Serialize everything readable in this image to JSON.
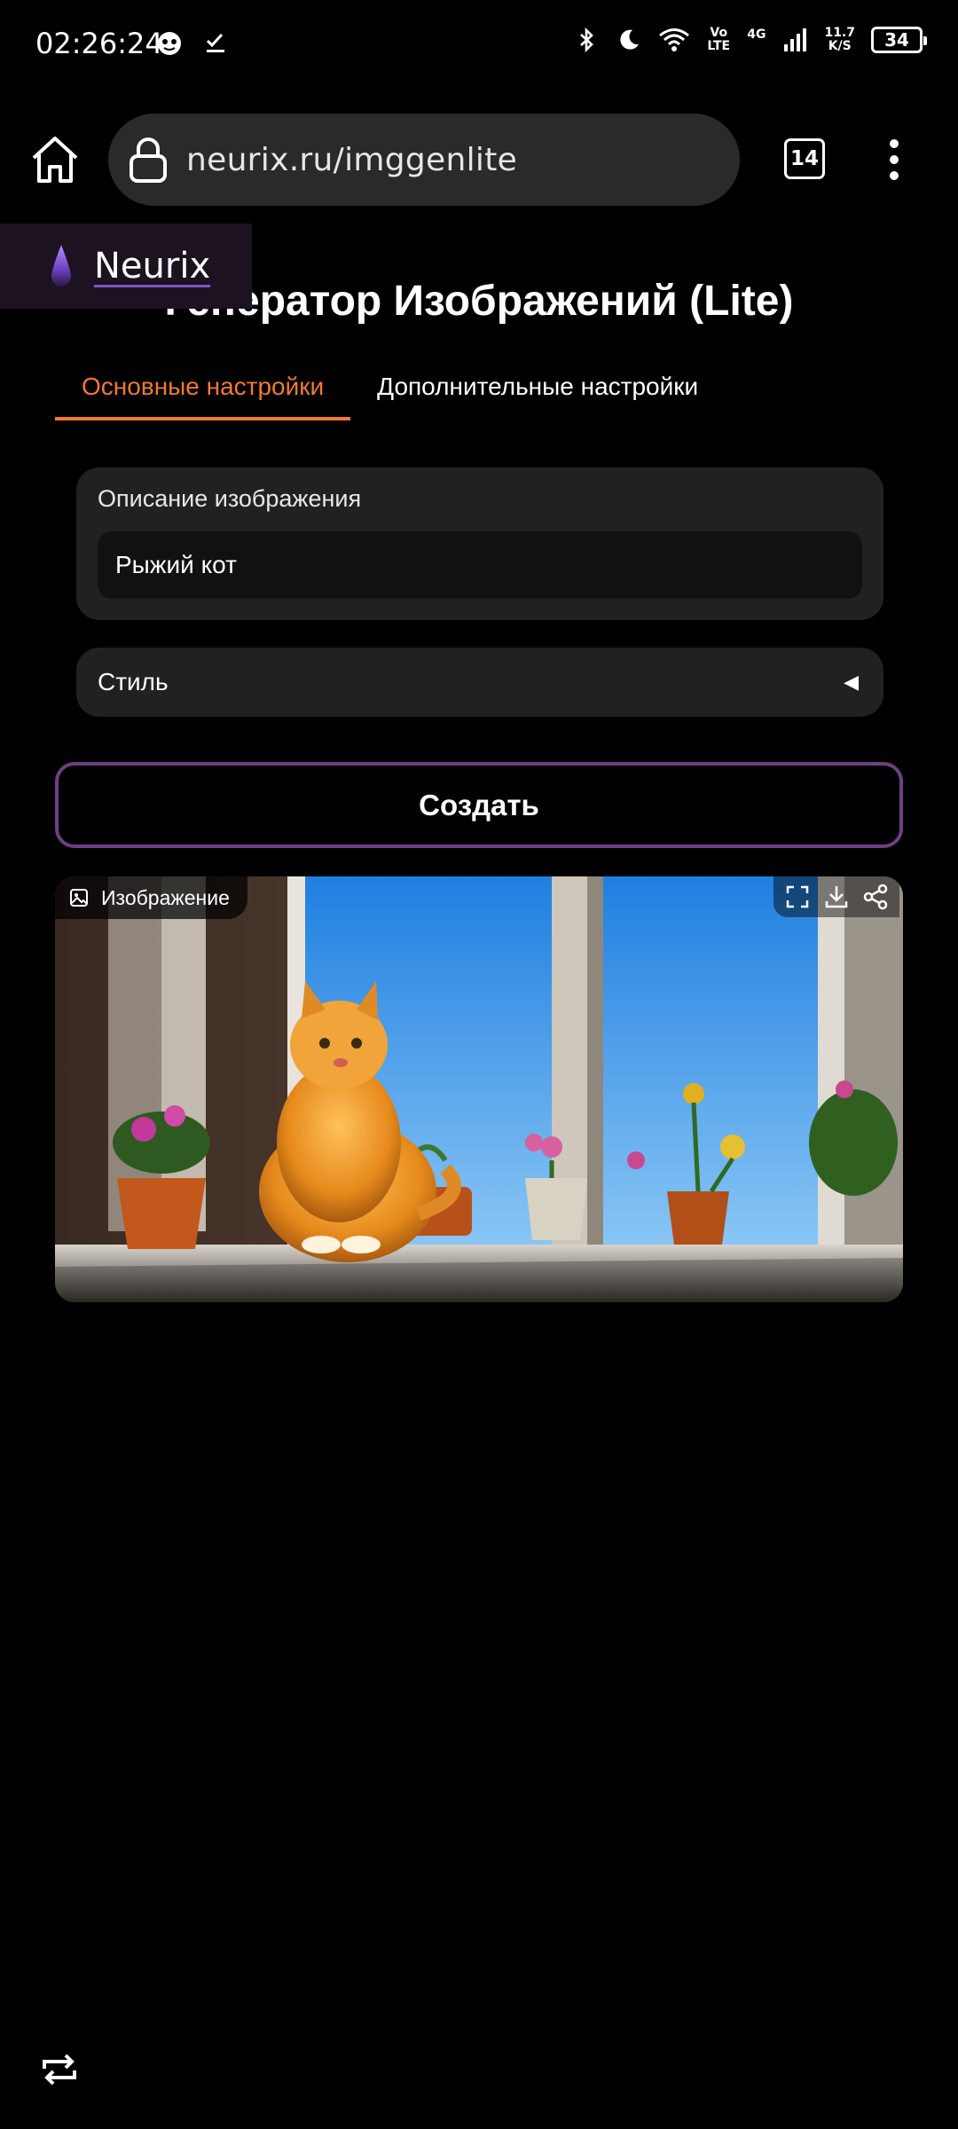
{
  "status_bar": {
    "time": "02:26:24",
    "volte": "Vo LTE",
    "network": "4G",
    "speed_value": "11.7",
    "speed_unit": "K/S",
    "battery": "34"
  },
  "browser": {
    "url": "neurix.ru/imggenlite",
    "tab_count": "14"
  },
  "header": {
    "brand": "Neurix",
    "title": "Генератор Изображений (Lite)"
  },
  "tabs": [
    {
      "label": "Основные настройки",
      "active": true
    },
    {
      "label": "Дополнительные настройки",
      "active": false
    }
  ],
  "form": {
    "description_label": "Описание изображения",
    "description_value": "Рыжий кот",
    "style_label": "Стиль",
    "create_label": "Создать"
  },
  "output": {
    "label": "Изображение"
  },
  "colors": {
    "accent": "#f07a30",
    "button_border": "#6e3f82",
    "card_bg": "#212121"
  },
  "icons": [
    "home-icon",
    "lock-icon",
    "menu-icon",
    "image-icon",
    "fullscreen-icon",
    "download-icon",
    "share-icon",
    "repeat-icon"
  ]
}
